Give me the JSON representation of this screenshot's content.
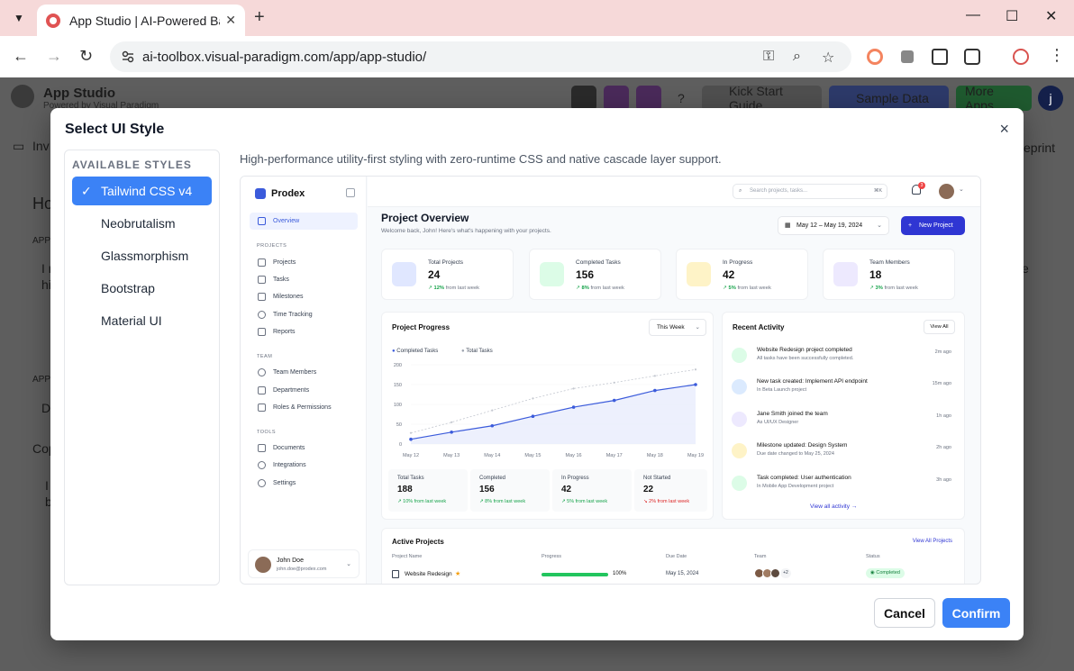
{
  "browser": {
    "tab_title": "App Studio | AI-Powered Backend",
    "url": "ai-toolbox.visual-paradigm.com/app/app-studio/",
    "new_tab_symbol": "+",
    "window_controls": [
      "—",
      "☐",
      "✕"
    ]
  },
  "app": {
    "title": "App Studio",
    "subtitle": "Powered by Visual Paradigm",
    "kick_start": "Kick Start Guide",
    "sample_data": "Sample Data",
    "more_apps": "More Apps",
    "user_initial": "j",
    "bg_tab": "Inv",
    "bg_blueprint": "eprint",
    "bg_heading": "Ho",
    "bg_app1": "APP",
    "bg_line1": "I r",
    "bg_line2": "hi",
    "bg_app2": "APP",
    "bg_d": "D",
    "bg_cop": "Cop",
    "bg_i": "I",
    "bg_b": "b",
    "bg_e": "e"
  },
  "modal": {
    "title": "Select UI Style",
    "close": "×",
    "styles_heading": "AVAILABLE STYLES",
    "styles": [
      {
        "label": "Tailwind CSS v4",
        "selected": true
      },
      {
        "label": "Neobrutalism",
        "selected": false
      },
      {
        "label": "Glassmorphism",
        "selected": false
      },
      {
        "label": "Bootstrap",
        "selected": false
      },
      {
        "label": "Material UI",
        "selected": false
      }
    ],
    "description": "High-performance utility-first styling with zero-runtime CSS and native cascade layer support.",
    "cancel": "Cancel",
    "confirm": "Confirm",
    "accent_color": "#3b82f6"
  },
  "preview": {
    "brand": "Prodex",
    "nav": {
      "overview": "Overview",
      "sec_projects": "PROJECTS",
      "projects": "Projects",
      "tasks": "Tasks",
      "milestones": "Milestones",
      "time_tracking": "Time Tracking",
      "reports": "Reports",
      "sec_team": "TEAM",
      "team_members": "Team Members",
      "departments": "Departments",
      "roles": "Roles & Permissions",
      "sec_tools": "TOOLS",
      "documents": "Documents",
      "integrations": "Integrations",
      "settings": "Settings"
    },
    "user": {
      "name": "John Doe",
      "email": "john.doe@prodex.com"
    },
    "search_placeholder": "Search projects, tasks...",
    "search_kbd": "⌘K",
    "notif_count": "3",
    "page_title": "Project Overview",
    "page_sub": "Welcome back, John! Here's what's happening with your projects.",
    "date_range": "May 12 – May 19, 2024",
    "new_project": "New Project",
    "stats": [
      {
        "label": "Total Projects",
        "value": "24",
        "delta": "12%",
        "delta_text": "from last week",
        "color": "#e0e7ff"
      },
      {
        "label": "Completed Tasks",
        "value": "156",
        "delta": "8%",
        "delta_text": "from last week",
        "color": "#dcfce7"
      },
      {
        "label": "In Progress",
        "value": "42",
        "delta": "5%",
        "delta_text": "from last week",
        "color": "#fef3c7"
      },
      {
        "label": "Team Members",
        "value": "18",
        "delta": "3%",
        "delta_text": "from last week",
        "color": "#ede9fe"
      }
    ],
    "progress_title": "Project Progress",
    "progress_range": "This Week",
    "legend_completed": "Completed Tasks",
    "legend_total": "Total Tasks",
    "mini_stats": [
      {
        "label": "Total Tasks",
        "value": "188",
        "delta": "↗ 10% from last week",
        "neg": false
      },
      {
        "label": "Completed",
        "value": "156",
        "delta": "↗ 8% from last week",
        "neg": false
      },
      {
        "label": "In Progress",
        "value": "42",
        "delta": "↗ 5% from last week",
        "neg": false
      },
      {
        "label": "Not Started",
        "value": "22",
        "delta": "↘ 2% from last week",
        "neg": true
      }
    ],
    "activity_title": "Recent Activity",
    "view_all": "View All",
    "activities": [
      {
        "title": "Website Redesign project completed",
        "sub": "All tasks have been successfully completed.",
        "time": "2m ago",
        "color": "#dcfce7"
      },
      {
        "title": "New task created: Implement API endpoint",
        "sub": "In Beta Launch project",
        "time": "15m ago",
        "color": "#dbeafe"
      },
      {
        "title": "Jane Smith joined the team",
        "sub": "As UI/UX Designer",
        "time": "1h ago",
        "color": "#ede9fe"
      },
      {
        "title": "Milestone updated: Design System",
        "sub": "Due date changed to May 25, 2024",
        "time": "2h ago",
        "color": "#fef3c7"
      },
      {
        "title": "Task completed: User authentication",
        "sub": "In Mobile App Development project",
        "time": "3h ago",
        "color": "#dcfce7"
      }
    ],
    "view_all_activity": "View all activity →",
    "active_title": "Active Projects",
    "view_all_projects": "View All Projects",
    "cols": {
      "name": "Project Name",
      "progress": "Progress",
      "due": "Due Date",
      "team": "Team",
      "status": "Status"
    },
    "row": {
      "name": "Website Redesign",
      "star": "★",
      "progress": "100%",
      "progress_value": 1.0,
      "due": "May 15, 2024",
      "team_extra": "+2",
      "status": "Completed"
    }
  },
  "chart_data": {
    "type": "line",
    "title": "Project Progress",
    "x": [
      "May 12",
      "May 13",
      "May 14",
      "May 15",
      "May 16",
      "May 17",
      "May 18",
      "May 19"
    ],
    "series": [
      {
        "name": "Completed Tasks",
        "values": [
          12,
          30,
          46,
          70,
          93,
          110,
          135,
          150
        ]
      },
      {
        "name": "Total Tasks",
        "values": [
          28,
          55,
          85,
          115,
          140,
          155,
          172,
          188
        ]
      }
    ],
    "yticks": [
      "0",
      "50",
      "100",
      "150",
      "200"
    ],
    "ylim": [
      0,
      200
    ],
    "colors": [
      "#3b5bdb",
      "#c4c8d0"
    ]
  }
}
